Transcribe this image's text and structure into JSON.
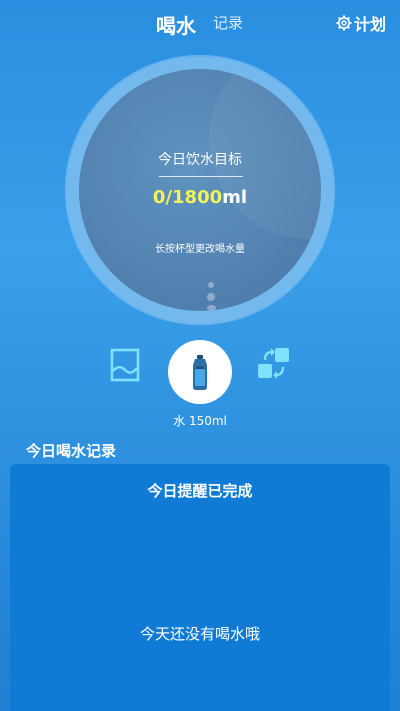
{
  "header": {
    "tabs": [
      {
        "label": "喝水",
        "active": true
      },
      {
        "label": "记录",
        "active": false
      }
    ],
    "plan_label": "计划",
    "plan_icon": "gear-icon"
  },
  "goal": {
    "title": "今日饮水目标",
    "current": "0",
    "separator": "/",
    "target": "1800",
    "unit": "ml",
    "hint": "长按杯型更改喝水量"
  },
  "controls": {
    "left_icon": "water-level-icon",
    "cup_icon": "water-bottle-icon",
    "right_icon": "swap-icon",
    "cup_label": "水 150ml"
  },
  "records": {
    "title": "今日喝水记录",
    "status": "今日提醒已完成",
    "empty_text": "今天还没有喝水哦"
  },
  "colors": {
    "accent_yellow": "#f2f25a",
    "panel_blue": "#0f7bd4",
    "icon_cyan": "#7fe3ff"
  }
}
